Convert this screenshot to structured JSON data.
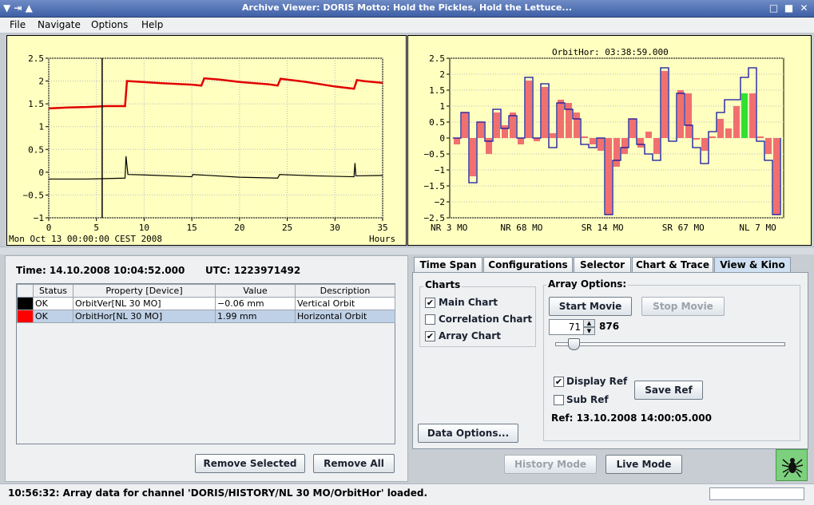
{
  "window": {
    "title": "Archive Viewer: DORIS     Motto: Hold the Pickles, Hold the Lettuce...",
    "buttons": {
      "minimize": "□",
      "maximize": "■",
      "close": "✕",
      "system": "▼  ⇥  ▲"
    }
  },
  "menu": {
    "file": "File",
    "navigate": "Navigate",
    "options": "Options",
    "help": "Help"
  },
  "main_chart": {
    "y_ticks": [
      "2.5",
      "2",
      "1.5",
      "1",
      "0.5",
      "0",
      "−0.5",
      "−1"
    ],
    "x_ticks": [
      "0",
      "5",
      "10",
      "15",
      "20",
      "25",
      "30",
      "35"
    ],
    "start_label": "Mon Oct 13 00:00:00 CEST 2008",
    "x_unit": "Hours"
  },
  "array_chart": {
    "title": "OrbitHor: 03:38:59.000",
    "y_ticks": [
      "2.5",
      "2",
      "1.5",
      "1",
      "0.5",
      "0",
      "−0.5",
      "−1",
      "−1.5",
      "−2",
      "−2.5"
    ],
    "x_labels": [
      "NR  3 MO",
      "NR 68 MO",
      "SR 14 MO",
      "SR 67 MO",
      "NL  7 MO"
    ]
  },
  "chart_data": [
    {
      "type": "line",
      "title": "",
      "xlabel": "Hours",
      "ylabel": "",
      "xlim": [
        0,
        35
      ],
      "ylim": [
        -1,
        2.5
      ],
      "grid": true,
      "cursor_x": 5.6,
      "series": [
        {
          "name": "OrbitHor[NL 30 MO]",
          "color": "#e00000",
          "x": [
            0,
            2,
            4,
            6,
            8,
            8.2,
            9,
            12,
            15,
            16,
            16.3,
            18,
            20,
            23,
            24,
            24.3,
            27,
            30,
            32,
            32.3,
            33,
            35
          ],
          "y": [
            1.4,
            1.42,
            1.43,
            1.45,
            1.45,
            2.0,
            1.99,
            1.95,
            1.92,
            1.9,
            2.06,
            2.03,
            1.98,
            1.93,
            1.9,
            2.05,
            1.98,
            1.88,
            1.83,
            2.02,
            2.0,
            1.96
          ]
        },
        {
          "name": "OrbitVer[NL 30 MO]",
          "color": "#000000",
          "x": [
            0,
            4,
            8,
            8.1,
            8.3,
            10,
            15,
            15.1,
            20,
            24,
            24.2,
            28,
            32,
            32.1,
            32.2,
            35
          ],
          "y": [
            -0.15,
            -0.15,
            -0.13,
            0.35,
            -0.05,
            -0.06,
            -0.1,
            -0.05,
            -0.11,
            -0.13,
            -0.05,
            -0.08,
            -0.1,
            0.2,
            -0.08,
            -0.07
          ]
        }
      ]
    },
    {
      "type": "bar",
      "title": "OrbitHor: 03:38:59.000",
      "xlabel": "",
      "ylabel": "",
      "ylim": [
        -2.5,
        2.5
      ],
      "grid": true,
      "series": [
        {
          "name": "",
          "color": "#f07070",
          "values": [
            -0.2,
            0.8,
            -1.2,
            0.5,
            -0.5,
            0.8,
            0.4,
            0.8,
            -0.2,
            1.8,
            -0.1,
            1.6,
            0.15,
            1.2,
            1.1,
            0.8,
            0.05,
            -0.2,
            -0.4,
            -2.4,
            -0.9,
            -0.5,
            0.6,
            -0.3,
            0.2,
            -0.5,
            2.1,
            0.0,
            1.5,
            1.4,
            -0.05,
            -0.4,
            0.05,
            0.6,
            0.3,
            1.0,
            1.4,
            1.4,
            0.05,
            -0.5,
            -2.4
          ]
        },
        {
          "name": "Reference",
          "color": "#1010a0",
          "style": "step",
          "values": [
            0.0,
            0.8,
            -1.4,
            0.5,
            -0.1,
            0.9,
            0.3,
            0.7,
            0.0,
            1.9,
            0.0,
            1.7,
            -0.3,
            1.1,
            0.9,
            0.6,
            -0.2,
            -0.3,
            0.0,
            -2.4,
            -0.7,
            -0.3,
            0.6,
            -0.2,
            -0.5,
            -0.7,
            2.2,
            -0.1,
            1.4,
            0.4,
            -0.3,
            -0.8,
            0.2,
            0.8,
            1.2,
            1.2,
            1.9,
            2.2,
            -0.1,
            -0.7,
            -2.4
          ]
        }
      ],
      "highlight_index": 36,
      "highlight_color": "#30e030"
    }
  ],
  "status_panel": {
    "time_label": "Time: 14.10.2008 10:04:52.000",
    "utc_label": "UTC: 1223971492"
  },
  "table": {
    "headers": [
      "Status",
      "Property [Device]",
      "Value",
      "Description"
    ],
    "rows": [
      {
        "color": "#000000",
        "status": "OK",
        "property": "OrbitVer[NL 30 MO]",
        "value": "−0.06 mm",
        "description": "Vertical Orbit"
      },
      {
        "color": "#ff0000",
        "status": "OK",
        "property": "OrbitHor[NL 30 MO]",
        "value": "1.99 mm",
        "description": "Horizontal Orbit"
      }
    ]
  },
  "buttons": {
    "remove_selected": "Remove Selected",
    "remove_all": "Remove All",
    "history_mode": "History Mode",
    "live_mode": "Live Mode"
  },
  "tabs": [
    "Time Span",
    "Configurations",
    "Selector",
    "Chart & Trace",
    "View & Kino"
  ],
  "charts_group": {
    "title": "Charts",
    "main": "Main Chart",
    "correlation": "Correlation Chart",
    "array": "Array Chart"
  },
  "array_options": {
    "title": "Array Options:",
    "start_movie": "Start Movie",
    "stop_movie": "Stop Movie",
    "frame": "71",
    "total": "876",
    "slider_fraction": 0.081,
    "display_ref": "Display Ref",
    "sub_ref": "Sub Ref",
    "save_ref": "Save Ref",
    "ref_label": "Ref: 13.10.2008 14:00:05.000"
  },
  "data_options": "Data Options...",
  "statusbar": {
    "message": "10:56:32: Array data for channel 'DORIS/HISTORY/NL 30 MO/OrbitHor' loaded."
  }
}
